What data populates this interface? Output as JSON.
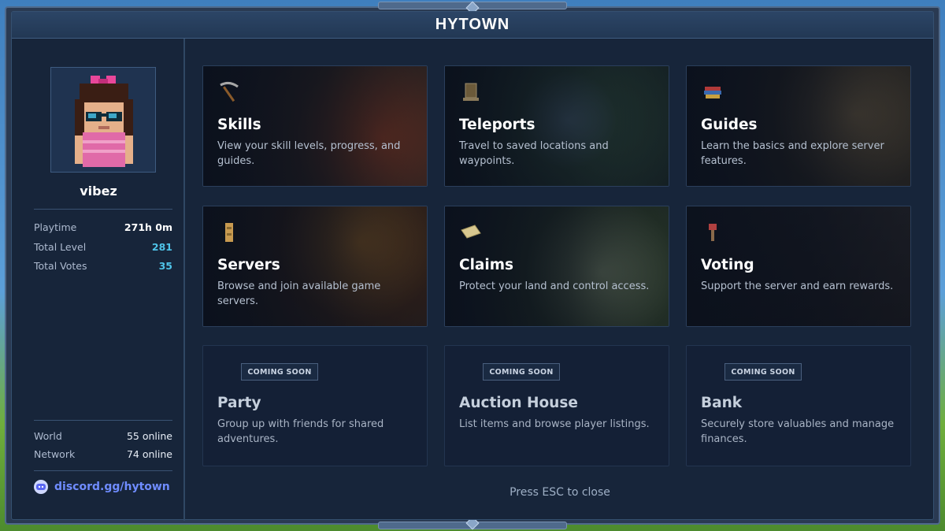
{
  "window": {
    "title": "HYTOWN"
  },
  "profile": {
    "username": "vibez",
    "stats": [
      {
        "label": "Playtime",
        "value": "271h 0m",
        "accent": "#ffffff"
      },
      {
        "label": "Total Level",
        "value": "281",
        "accent": "#4fc3e8"
      },
      {
        "label": "Total Votes",
        "value": "35",
        "accent": "#4fc3e8"
      }
    ],
    "online": [
      {
        "label": "World",
        "value": "55 online"
      },
      {
        "label": "Network",
        "value": "74 online"
      }
    ],
    "discord": {
      "label": "discord.gg/hytown",
      "icon": "discord-icon",
      "color": "#6f8cff"
    }
  },
  "menu": {
    "cards": [
      {
        "id": "skills",
        "icon": "pickaxe-icon",
        "title": "Skills",
        "description": "View your skill levels, progress, and guides.",
        "bg": [
          "#3a2a22",
          "#8a3b22"
        ]
      },
      {
        "id": "teleports",
        "icon": "teleport-pad-icon",
        "title": "Teleports",
        "description": "Travel to saved locations and waypoints.",
        "bg": [
          "#203a2a",
          "#4c6a7a"
        ]
      },
      {
        "id": "guides",
        "icon": "books-icon",
        "title": "Guides",
        "description": "Learn the basics and explore server features.",
        "bg": [
          "#2a2a2a",
          "#5a5040"
        ]
      },
      {
        "id": "servers",
        "icon": "server-totem-icon",
        "title": "Servers",
        "description": "Browse and join available game servers.",
        "bg": [
          "#3a2418",
          "#7a4a22"
        ]
      },
      {
        "id": "claims",
        "icon": "map-scroll-icon",
        "title": "Claims",
        "description": "Protect your land and control access.",
        "bg": [
          "#1e2e20",
          "#6a7a5a"
        ]
      },
      {
        "id": "voting",
        "icon": "vote-icon",
        "title": "Voting",
        "description": "Support the server and earn rewards.",
        "bg": [
          "#1c1c20",
          "#2e2e34"
        ]
      }
    ],
    "coming_soon": [
      {
        "id": "party",
        "badge": "COMING SOON",
        "title": "Party",
        "description": "Group up with friends for shared adventures."
      },
      {
        "id": "auction-house",
        "badge": "COMING SOON",
        "title": "Auction House",
        "description": "List items and browse player listings."
      },
      {
        "id": "bank",
        "badge": "COMING SOON",
        "title": "Bank",
        "description": "Securely store valuables and manage finances."
      }
    ]
  },
  "footer": {
    "hint": "Press ESC to close"
  }
}
